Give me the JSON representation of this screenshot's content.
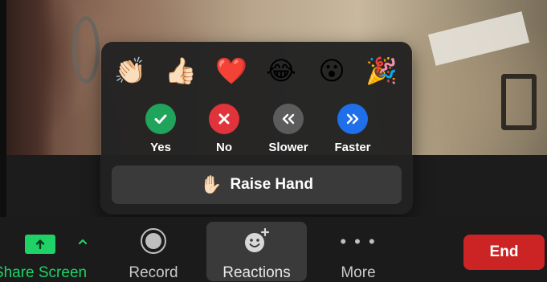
{
  "reactions_popup": {
    "emojis": [
      {
        "icon": "clapping-hands-icon",
        "glyph": "👏🏻"
      },
      {
        "icon": "thumbs-up-icon",
        "glyph": "👍🏻"
      },
      {
        "icon": "red-heart-icon",
        "glyph": "❤️"
      },
      {
        "icon": "tears-of-joy-icon",
        "glyph": "😂"
      },
      {
        "icon": "surprised-face-icon",
        "glyph": "😮"
      },
      {
        "icon": "party-popper-icon",
        "glyph": "🎉"
      }
    ],
    "feedback": [
      {
        "label": "Yes",
        "icon": "checkmark-icon",
        "color": "#20a35a"
      },
      {
        "label": "No",
        "icon": "x-icon",
        "color": "#e0333c"
      },
      {
        "label": "Slower",
        "icon": "rewind-icon",
        "color": "#5c5c5c"
      },
      {
        "label": "Faster",
        "icon": "fast-forward-icon",
        "color": "#1f6fea"
      }
    ],
    "raise_hand": {
      "label": "Raise Hand",
      "icon": "raised-hand-icon",
      "glyph": "✋🏻"
    }
  },
  "toolbar": {
    "share_screen": {
      "label": "Share Screen",
      "icon": "share-screen-up-arrow-icon",
      "color": "#1fd267"
    },
    "record": {
      "label": "Record",
      "icon": "record-icon"
    },
    "reactions": {
      "label": "Reactions",
      "icon": "smiley-plus-icon"
    },
    "more": {
      "label": "More",
      "icon": "ellipsis-icon",
      "glyph": "• • •"
    },
    "end": {
      "label": "End",
      "color": "#cc2424"
    }
  }
}
